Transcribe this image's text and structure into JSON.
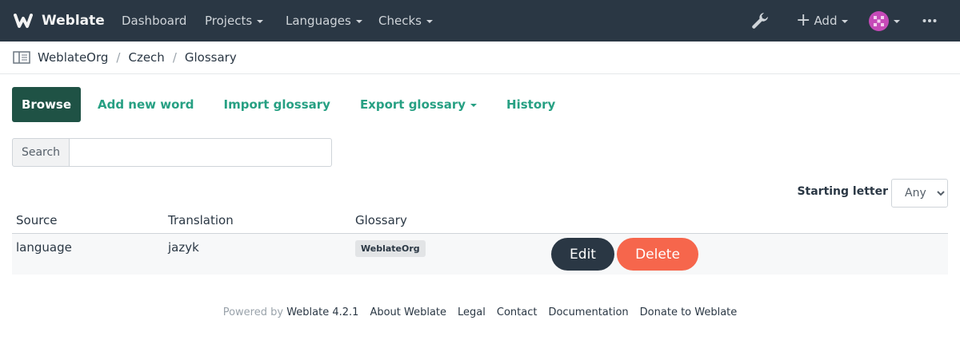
{
  "navbar": {
    "brand": "Weblate",
    "items": [
      {
        "label": "Dashboard"
      },
      {
        "label": "Projects"
      },
      {
        "label": "Languages"
      },
      {
        "label": "Checks"
      }
    ],
    "add_label": "Add"
  },
  "breadcrumb": [
    "WeblateOrg",
    "Czech",
    "Glossary"
  ],
  "tabs": {
    "browse": "Browse",
    "add_new_word": "Add new word",
    "import_glossary": "Import glossary",
    "export_glossary": "Export glossary",
    "history": "History"
  },
  "search": {
    "addon": "Search",
    "value": ""
  },
  "filter": {
    "label": "Starting letter",
    "selected": "Any"
  },
  "table": {
    "headers": [
      "Source",
      "Translation",
      "Glossary"
    ],
    "rows": [
      {
        "source": "language",
        "translation": "jazyk",
        "glossary": "WeblateOrg",
        "edit": "Edit",
        "delete": "Delete"
      }
    ]
  },
  "footer": {
    "powered_by": "Powered by",
    "version": "Weblate 4.2.1",
    "links": [
      "About Weblate",
      "Legal",
      "Contact",
      "Documentation",
      "Donate to Weblate"
    ]
  }
}
